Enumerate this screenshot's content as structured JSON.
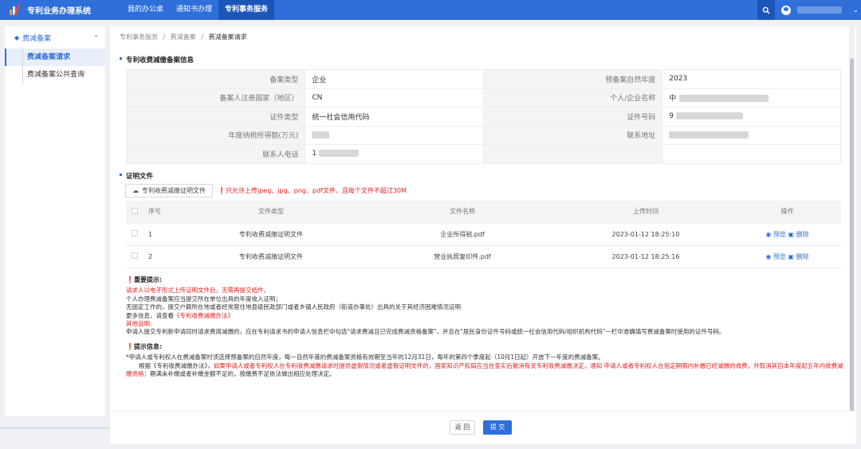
{
  "app": {
    "title": "专利业务办理系统"
  },
  "nav": [
    {
      "label": "我的办公桌"
    },
    {
      "label": "通知书办理"
    },
    {
      "label": "专利事务服务"
    }
  ],
  "sidebar": {
    "group": "费减备案",
    "items": [
      {
        "label": "费减备案请求"
      },
      {
        "label": "费减备案公共查询"
      }
    ]
  },
  "breadcrumb": {
    "a": "专利事务服务",
    "sep": "/",
    "b": "费减备案",
    "c": "费减备案请求"
  },
  "info": {
    "title": "专利收费减缴备案信息",
    "rows": [
      {
        "k1": "备案类型",
        "v1": "企业",
        "k2": "预备案自然年度",
        "v2": "2023"
      },
      {
        "k1": "备案人注册国家（地区）",
        "v1": "CN",
        "k2": "个人/企业名称",
        "v2": "中"
      },
      {
        "k1": "证件类型",
        "v1": "统一社会信用代码",
        "k2": "证件号码",
        "v2": "9"
      },
      {
        "k1": "年度纳税所得额(万元)",
        "v1": "",
        "k2": "联系地址",
        "v2": ""
      },
      {
        "k1": "联系人电话",
        "v1": "1",
        "k2": "",
        "v2": ""
      }
    ]
  },
  "files": {
    "title": "证明文件",
    "upload_label": "专利收费减缴证明文件",
    "upload_tip": "只允许上传jpeg、jpg、png、pdf文件，且每个文件不超过30M",
    "headers": [
      "序号",
      "文件类型",
      "文件名称",
      "上传时间",
      "操作"
    ],
    "rows": [
      {
        "no": "1",
        "type": "专利收费减缴证明文件",
        "name": "企业所得税.pdf",
        "time": "2023-01-12 18:25:10"
      },
      {
        "no": "2",
        "type": "专利收费减缴证明文件",
        "name": "营业执照复印件.pdf",
        "time": "2023-01-12 18:25:16"
      }
    ],
    "op_preview": "预览",
    "op_delete": "删除"
  },
  "important": {
    "title": "重要提示:",
    "lines": [
      "请求人以电子形式上传证明文件后，无需再提交纸件。",
      "个人办理费减备案应当提交所在单位出具的年度收入证明；",
      "无固定工作的，提交户籍所在地或者经常居住地县级民政部门或者乡镇人民政府（街道办事处）出具的关于其经济困难情况证明",
      "更多信息，请查看",
      "《专利收费减缴办法》",
      "其他说明:",
      "申请人提交专利新申请同时请求费用减缴的，应在专利请求书的申请人信息栏中勾选\"请求费减且已完成费减资格备案\"，并且在\"居民身份证件号码或统一社会信用代码/组织机构代码\"一栏中准确填写费减备案时使用的证件号码。"
    ]
  },
  "hint": {
    "title": "提示信息:",
    "line1": "*申请人或专利权人在费减备案时须选择预备案的自然年度，每一自然年度的费减备案资格有效期至当年的12月31日，每年的第四个季度起（10月1日起）开放下一年度的费减备案。",
    "line2a": "根据《专利收费减缴办法》，",
    "line2b": "如果申请人或者专利权人在专利收费减缴请求时提供虚假情况或者虚假证明文件的，国家知识产权局应当在查实后撤消有关专利收费减缴决定，通知 申请人或者专利权人在指定期限内补缴已经减缴的收费，并取消其自本年度起五年内收费减缴资格；",
    "line2c": "期满未补缴或者补缴金额不足的，按缴费不足依法做出相应处理决定。"
  },
  "footer": {
    "back": "返 回",
    "submit": "提 交"
  }
}
